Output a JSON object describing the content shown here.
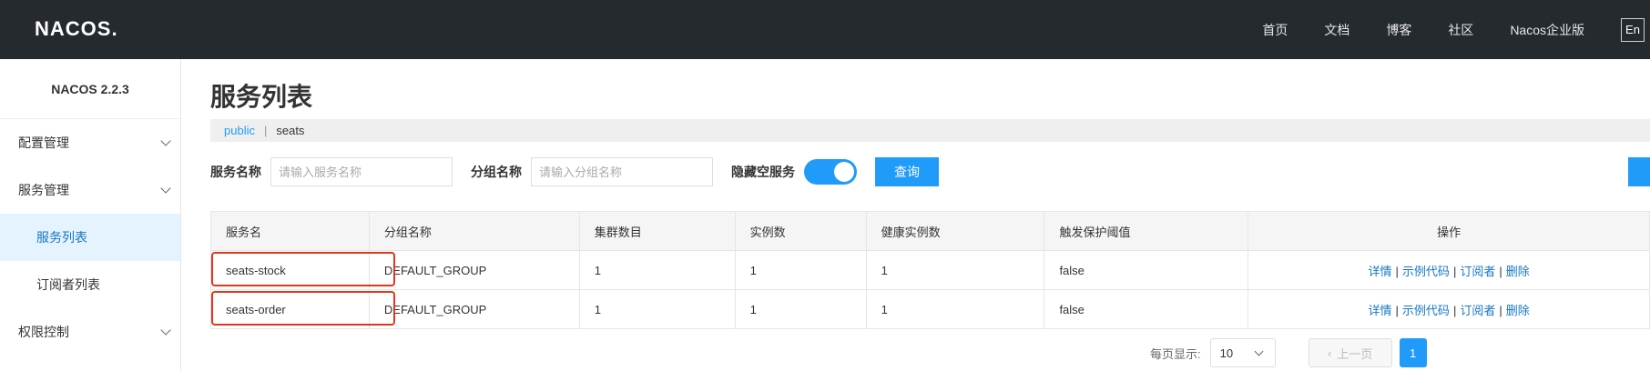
{
  "topbar": {
    "logo": "NACOS.",
    "nav": [
      "首页",
      "文档",
      "博客",
      "社区",
      "Nacos企业版"
    ],
    "lang": "En"
  },
  "sidebar": {
    "version": "NACOS 2.2.3",
    "items": [
      {
        "label": "配置管理"
      },
      {
        "label": "服务管理"
      },
      {
        "label": "服务列表"
      },
      {
        "label": "订阅者列表"
      },
      {
        "label": "权限控制"
      }
    ]
  },
  "main": {
    "title": "服务列表",
    "namespaces": {
      "active": "public",
      "separator": "|",
      "other": "seats"
    },
    "filter": {
      "service_label": "服务名称",
      "service_placeholder": "请输入服务名称",
      "group_label": "分组名称",
      "group_placeholder": "请输入分组名称",
      "hide_empty_label": "隐藏空服务",
      "query_label": "查询"
    },
    "table": {
      "headers": [
        "服务名",
        "分组名称",
        "集群数目",
        "实例数",
        "健康实例数",
        "触发保护阈值",
        "操作"
      ],
      "rows": [
        {
          "name": "seats-stock",
          "group": "DEFAULT_GROUP",
          "clusters": "1",
          "instances": "1",
          "healthy": "1",
          "threshold": "false"
        },
        {
          "name": "seats-order",
          "group": "DEFAULT_GROUP",
          "clusters": "1",
          "instances": "1",
          "healthy": "1",
          "threshold": "false"
        }
      ],
      "ops": {
        "detail": "详情",
        "sample": "示例代码",
        "subscriber": "订阅者",
        "delete": "删除",
        "sep": "|"
      }
    },
    "pager": {
      "size_label": "每页显示:",
      "size_value": "10",
      "prev_label": "上一页",
      "current_page": "1"
    }
  }
}
